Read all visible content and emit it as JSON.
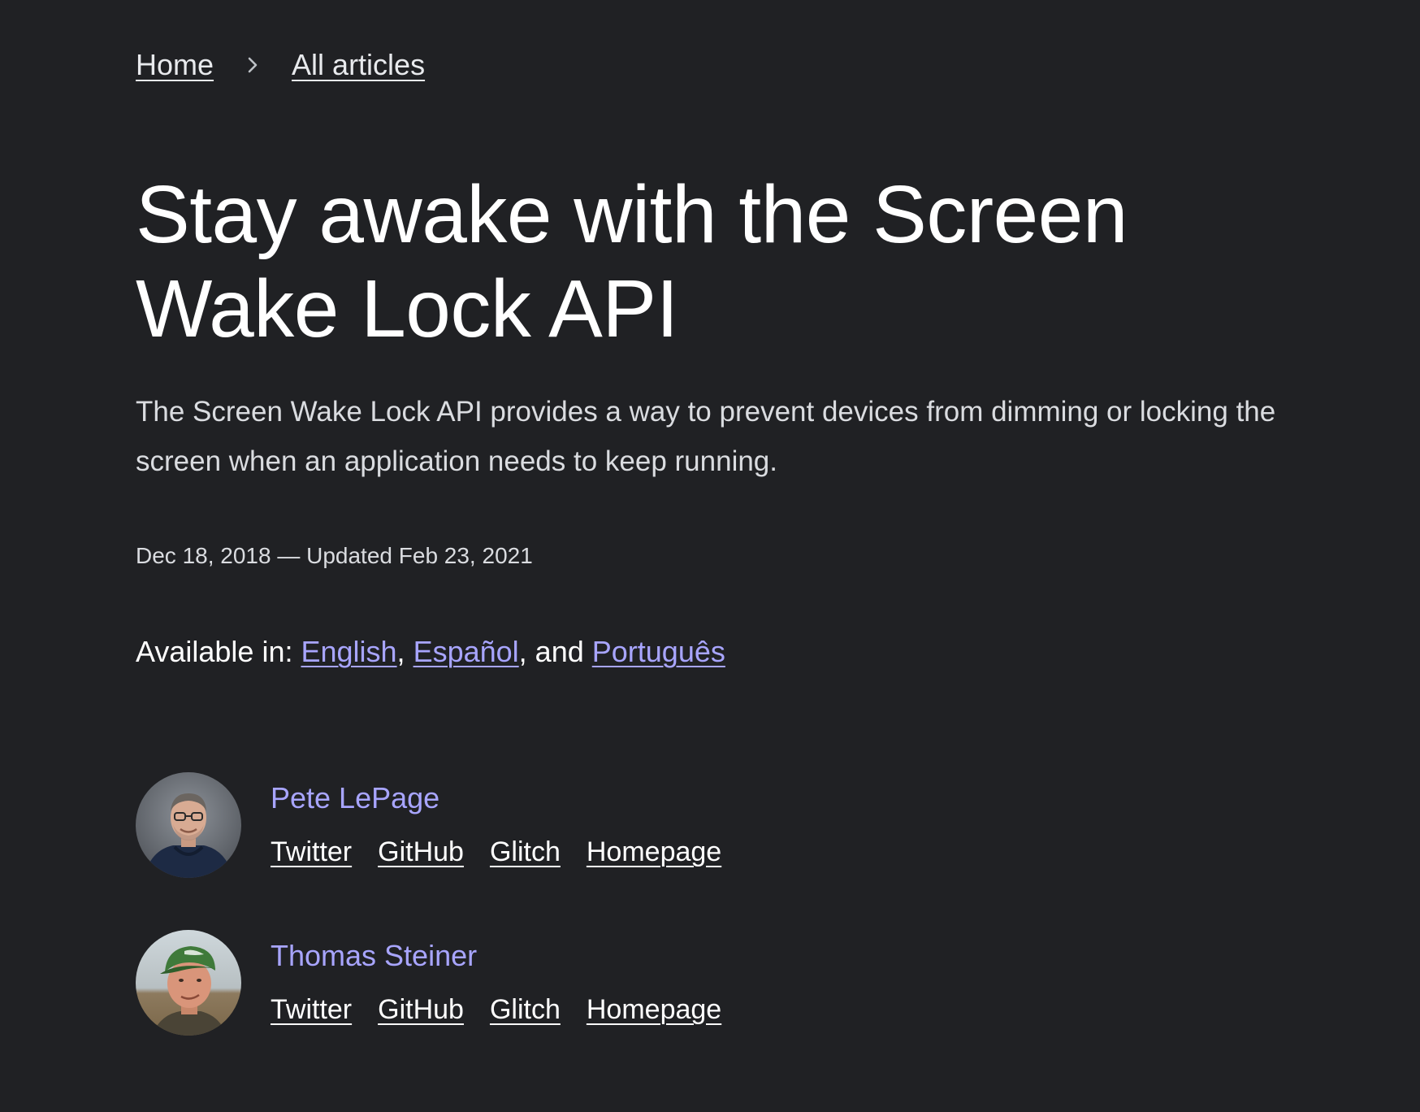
{
  "breadcrumb": {
    "home": "Home",
    "all_articles": "All articles",
    "separator_icon": "chevron-right-icon"
  },
  "article": {
    "title": "Stay awake with the Screen Wake Lock API",
    "subtitle": "The Screen Wake Lock API provides a way to prevent devices from dimming or locking the screen when an application needs to keep running.",
    "date": "Dec 18, 2018 — Updated Feb 23, 2021"
  },
  "languages": {
    "prefix": "Available in: ",
    "items": [
      "English",
      "Español",
      "Português"
    ],
    "sep1": ", ",
    "sep2": ", and "
  },
  "authors": [
    {
      "name": "Pete LePage",
      "links": [
        "Twitter",
        "GitHub",
        "Glitch",
        "Homepage"
      ]
    },
    {
      "name": "Thomas Steiner",
      "links": [
        "Twitter",
        "GitHub",
        "Glitch",
        "Homepage"
      ]
    }
  ],
  "colors": {
    "background": "#202124",
    "link_accent": "#a8a5ff",
    "text_primary": "#ffffff",
    "text_secondary": "#dadce0"
  }
}
